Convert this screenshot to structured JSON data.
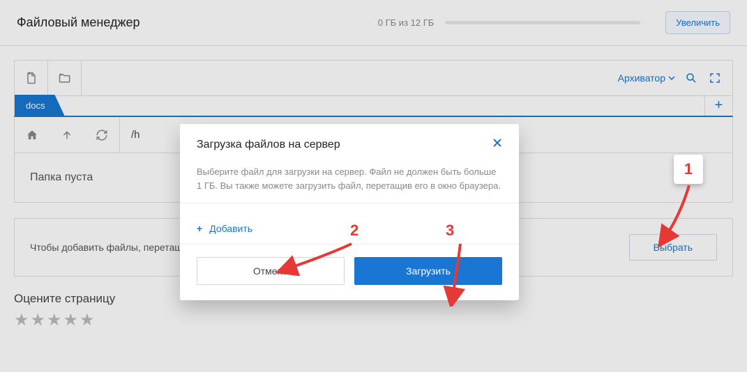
{
  "header": {
    "title": "Файловый менеджер",
    "storage_text": "0 ГБ из 12 ГБ",
    "increase_label": "Увеличить"
  },
  "toolbar": {
    "archiver_label": "Архиватор"
  },
  "tabs": {
    "active": "docs",
    "path_prefix": "/h"
  },
  "main": {
    "empty_text": "Папка пуста",
    "hint_text": "Чтобы добавить файлы, перетащ",
    "select_label": "Выбрать"
  },
  "rate": {
    "title": "Оцените страницу"
  },
  "modal": {
    "title": "Загрузка файлов на сервер",
    "body_text": "Выберите файл для загрузки на сервер. Файл не должен быть больше 1 ГБ. Вы также можете загрузить файл, перетащив его в окно браузера.",
    "add_label": "Добавить",
    "cancel_label": "Отмена",
    "upload_label": "Загрузить"
  },
  "annotations": {
    "n1": "1",
    "n2": "2",
    "n3": "3"
  }
}
